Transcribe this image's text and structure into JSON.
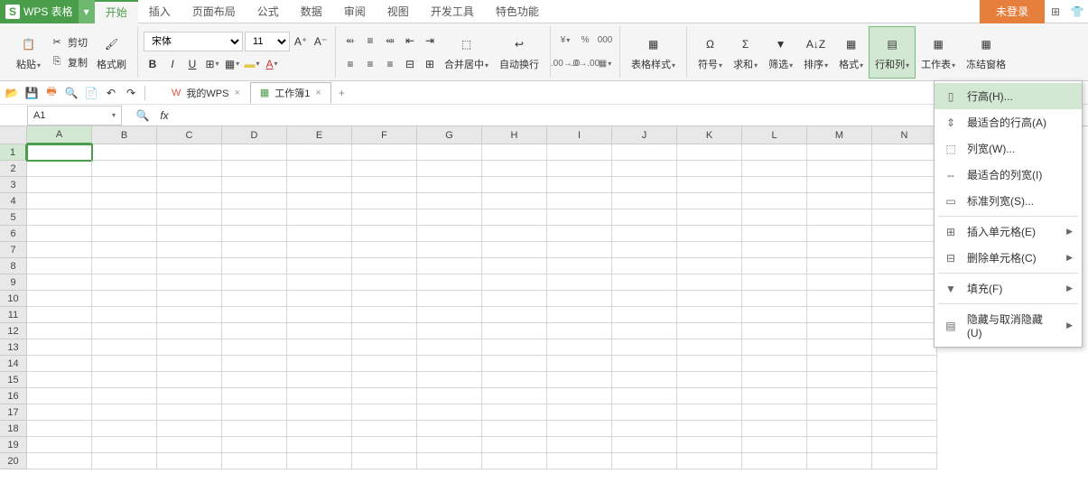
{
  "app": {
    "name": "WPS 表格"
  },
  "menu_tabs": [
    "开始",
    "插入",
    "页面布局",
    "公式",
    "数据",
    "审阅",
    "视图",
    "开发工具",
    "特色功能"
  ],
  "title_right": {
    "login": "未登录"
  },
  "ribbon": {
    "paste": "粘贴",
    "cut": "剪切",
    "copy": "复制",
    "format_painter": "格式刷",
    "font_name": "宋体",
    "font_size": "11",
    "merge_center": "合并居中",
    "wrap_text": "自动换行",
    "table_style": "表格样式",
    "symbol": "符号",
    "sum": "求和",
    "filter": "筛选",
    "sort": "排序",
    "format": "格式",
    "row_col": "行和列",
    "worksheet": "工作表",
    "freeze": "冻结窗格"
  },
  "doc_tabs": [
    {
      "label": "我的WPS",
      "icon_color": "#d54",
      "active": false
    },
    {
      "label": "工作簿1",
      "icon_color": "#4a9d4a",
      "active": true
    }
  ],
  "formula_bar": {
    "name_box": "A1"
  },
  "columns": [
    "A",
    "B",
    "C",
    "D",
    "E",
    "F",
    "G",
    "H",
    "I",
    "J",
    "K",
    "L",
    "M",
    "N"
  ],
  "rows": [
    1,
    2,
    3,
    4,
    5,
    6,
    7,
    8,
    9,
    10,
    11,
    12,
    13,
    14,
    15,
    16,
    17,
    18,
    19,
    20
  ],
  "dropdown": {
    "items": [
      {
        "label": "行高(H)...",
        "icon": "row-height-icon",
        "hover": true
      },
      {
        "label": "最适合的行高(A)",
        "icon": "fit-row-icon"
      },
      {
        "label": "列宽(W)...",
        "icon": "col-width-icon"
      },
      {
        "label": "最适合的列宽(I)",
        "icon": "fit-col-icon"
      },
      {
        "label": "标准列宽(S)...",
        "icon": "std-width-icon"
      },
      {
        "sep": true
      },
      {
        "label": "插入单元格(E)",
        "icon": "insert-cell-icon",
        "submenu": true
      },
      {
        "label": "删除单元格(C)",
        "icon": "delete-cell-icon",
        "submenu": true
      },
      {
        "sep": true
      },
      {
        "label": "填充(F)",
        "icon": "fill-icon",
        "submenu": true
      },
      {
        "sep": true
      },
      {
        "label": "隐藏与取消隐藏(U)",
        "icon": "hide-icon",
        "submenu": true
      }
    ]
  }
}
